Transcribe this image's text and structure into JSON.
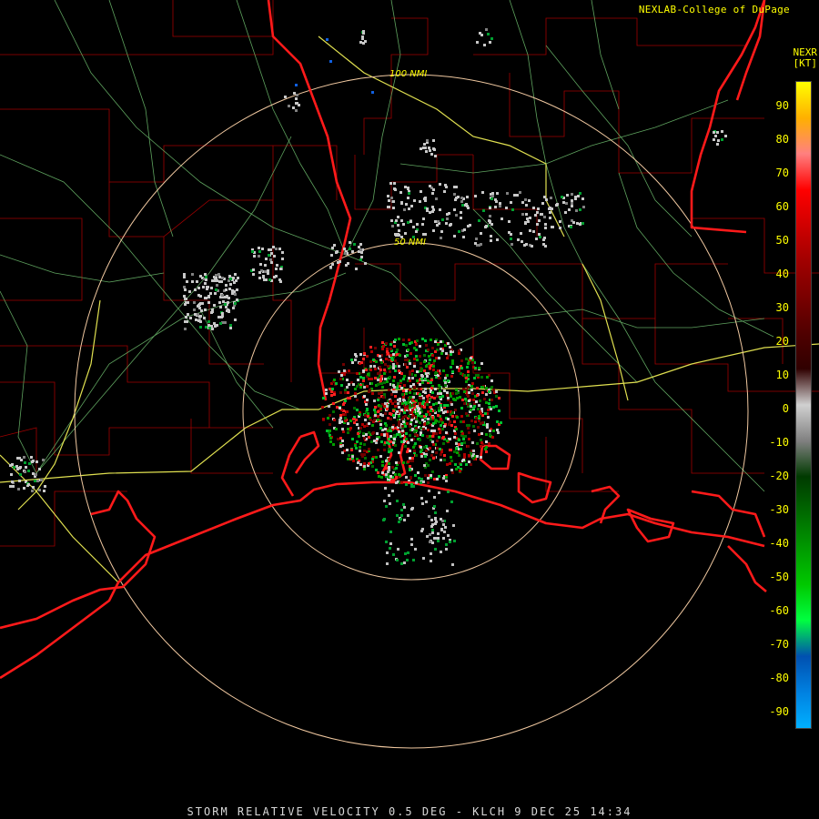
{
  "header": {
    "credit": "NEXLAB-College of DuPage",
    "product_code": "NEXR",
    "units": "[KT]"
  },
  "rings": {
    "outer_label": "100 NMI",
    "inner_label": "50 NMI"
  },
  "footer": {
    "caption": "STORM RELATIVE VELOCITY 0.5 DEG - KLCH 9 DEC 25 14:34"
  },
  "legend": {
    "ticks": [
      "90",
      "80",
      "70",
      "60",
      "50",
      "40",
      "30",
      "20",
      "10",
      "0",
      "-10",
      "-20",
      "-30",
      "-40",
      "-50",
      "-60",
      "-70",
      "-80",
      "-90"
    ],
    "colors": [
      "#ffff00",
      "#ffb000",
      "#ff8080",
      "#ff0000",
      "#d00000",
      "#a00000",
      "#7a0000",
      "#500000",
      "#300000",
      "#d0d0d0",
      "#808080",
      "#003a00",
      "#006a00",
      "#009a00",
      "#00c800",
      "#00ff40",
      "#0050b0",
      "#0080e0",
      "#00b0ff"
    ]
  },
  "colors": {
    "coast": "#ff1a1a",
    "county": "#b00000",
    "roads": "#80d080",
    "highway": "#e8e85a",
    "ring": "#f0c8a0"
  }
}
